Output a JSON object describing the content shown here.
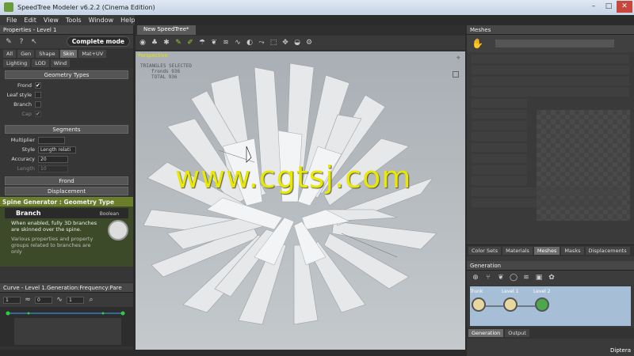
{
  "title": "SpeedTree Modeler v6.2.2 (Cinema Edition)",
  "window_buttons": {
    "minimize": "–",
    "maximize": "□",
    "close": "✕"
  },
  "menu": [
    "File",
    "Edit",
    "View",
    "Tools",
    "Window",
    "Help"
  ],
  "properties": {
    "title": "Properties - Level 1",
    "mode": "Complete mode",
    "tabs": [
      "All",
      "Gen",
      "Shape",
      "Skin",
      "Mat+UV",
      "Lighting",
      "LOD",
      "Wind"
    ],
    "active_tab": "Skin",
    "geometry_types": {
      "header": "Geometry Types",
      "rows": [
        {
          "label": "Frond",
          "checked": true
        },
        {
          "label": "Leaf style",
          "checked": false
        },
        {
          "label": "Branch",
          "checked": false
        },
        {
          "label": "Cap",
          "checked": true
        }
      ]
    },
    "segments": {
      "header": "Segments",
      "multiplier": "Multiplier",
      "style_label": "Style",
      "style_value": "Length relati",
      "accuracy_label": "Accuracy",
      "accuracy_value": "20",
      "length_label": "Length",
      "length_value": "10"
    },
    "frond": "Frond",
    "displacement": "Displacement",
    "info": {
      "title": "Spine Generator : Geometry Type",
      "heading": "Branch",
      "type": "Boolean",
      "text1": "When enabled, fully 3D branches are skinned over the spine.",
      "text2": "Various properties and property groups related to branches are only"
    }
  },
  "curve": {
    "title": "Curve - Level 1.Generation:Frequency:Pare",
    "value1": "1",
    "value2": "0",
    "value3": "1"
  },
  "viewport": {
    "tab": "New SpeedTree*",
    "label": "Perspective",
    "stats_header": "TRIANGLES  SELECTED",
    "fronds": "fronds 936",
    "total": "TOTAL 936"
  },
  "watermark": "www.cgtsj.com",
  "meshes": {
    "title": "Meshes",
    "tabs": [
      "Color Sets",
      "Materials",
      "Meshes",
      "Masks",
      "Displacements"
    ],
    "active_tab": "Meshes"
  },
  "generation": {
    "title": "Generation",
    "nodes": [
      "Trunk",
      "Level 1",
      "Level 2"
    ],
    "tabs": [
      "Generation",
      "Output"
    ],
    "active_tab": "Generation"
  },
  "footer": "Diptera",
  "colors": {
    "accent": "#d7d700",
    "panel": "#363636",
    "info_green": "#6a7d2a",
    "sky": "#b2b8bd"
  }
}
